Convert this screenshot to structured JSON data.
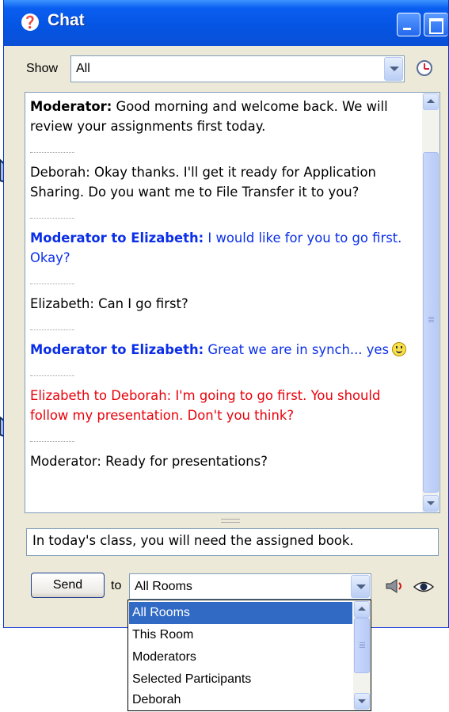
{
  "window": {
    "title": "Chat"
  },
  "show": {
    "label": "Show",
    "selected": "All"
  },
  "messages": {
    "m1": {
      "sender": "Moderator:",
      "text": " Good morning and welcome back. We will review your assignments first today."
    },
    "m2": {
      "text": "Deborah: Okay thanks.  I'll get it ready for Application Sharing. Do you want me to File Transfer it to you?"
    },
    "m3": {
      "sender": "Moderator to Elizabeth:",
      "text": " I would like for you to go first. Okay?"
    },
    "m4": {
      "text": "Elizabeth: Can I go first?"
    },
    "m5": {
      "sender": "Moderator to Elizabeth:",
      "text": " Great we are in synch... yes"
    },
    "m6": {
      "sender": "Elizabeth to Deborah:",
      "text": " I'm going to go first.  You should follow my presentation.  Don't you think?"
    },
    "m7": {
      "text": "Moderator: Ready for presentations?"
    }
  },
  "input": {
    "value": "In today's class, you will need the assigned book."
  },
  "send": {
    "label": "Send"
  },
  "to": {
    "label": "to",
    "selected": "All Rooms"
  },
  "recipients": [
    "All Rooms",
    "This Room",
    "Moderators",
    "Selected Participants",
    "Deborah"
  ],
  "colors": {
    "private_to_self": "#0b2fe8",
    "private_other": "#e8000a",
    "selection": "#316ac5",
    "titlebar": "#0554e2"
  }
}
